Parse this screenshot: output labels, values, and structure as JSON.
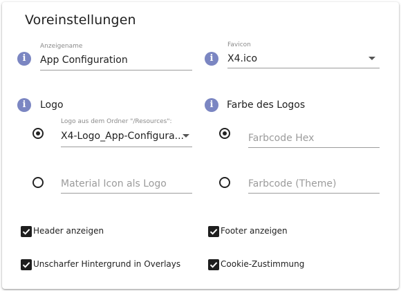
{
  "card": {
    "title": "Voreinstellungen"
  },
  "icons": {
    "info": "i"
  },
  "app_name": {
    "label": "Anzeigename",
    "value": "App Configuration"
  },
  "favicon": {
    "label": "Favicon",
    "value": "X4.ico"
  },
  "logo": {
    "section_label": "Logo",
    "select_label": "Logo aus dem Ordner \"/Resources\":",
    "select_value": "X4-Logo_App-Configura...",
    "material_icon_placeholder": "Material Icon als Logo"
  },
  "logo_color": {
    "section_label": "Farbe des Logos",
    "hex_placeholder": "Farbcode Hex",
    "theme_placeholder": "Farbcode (Theme)"
  },
  "checkboxes": {
    "header": "Header anzeigen",
    "footer": "Footer anzeigen",
    "blur": "Unscharfer Hintergrund in Overlays",
    "cookie": "Cookie-Zustimmung"
  }
}
